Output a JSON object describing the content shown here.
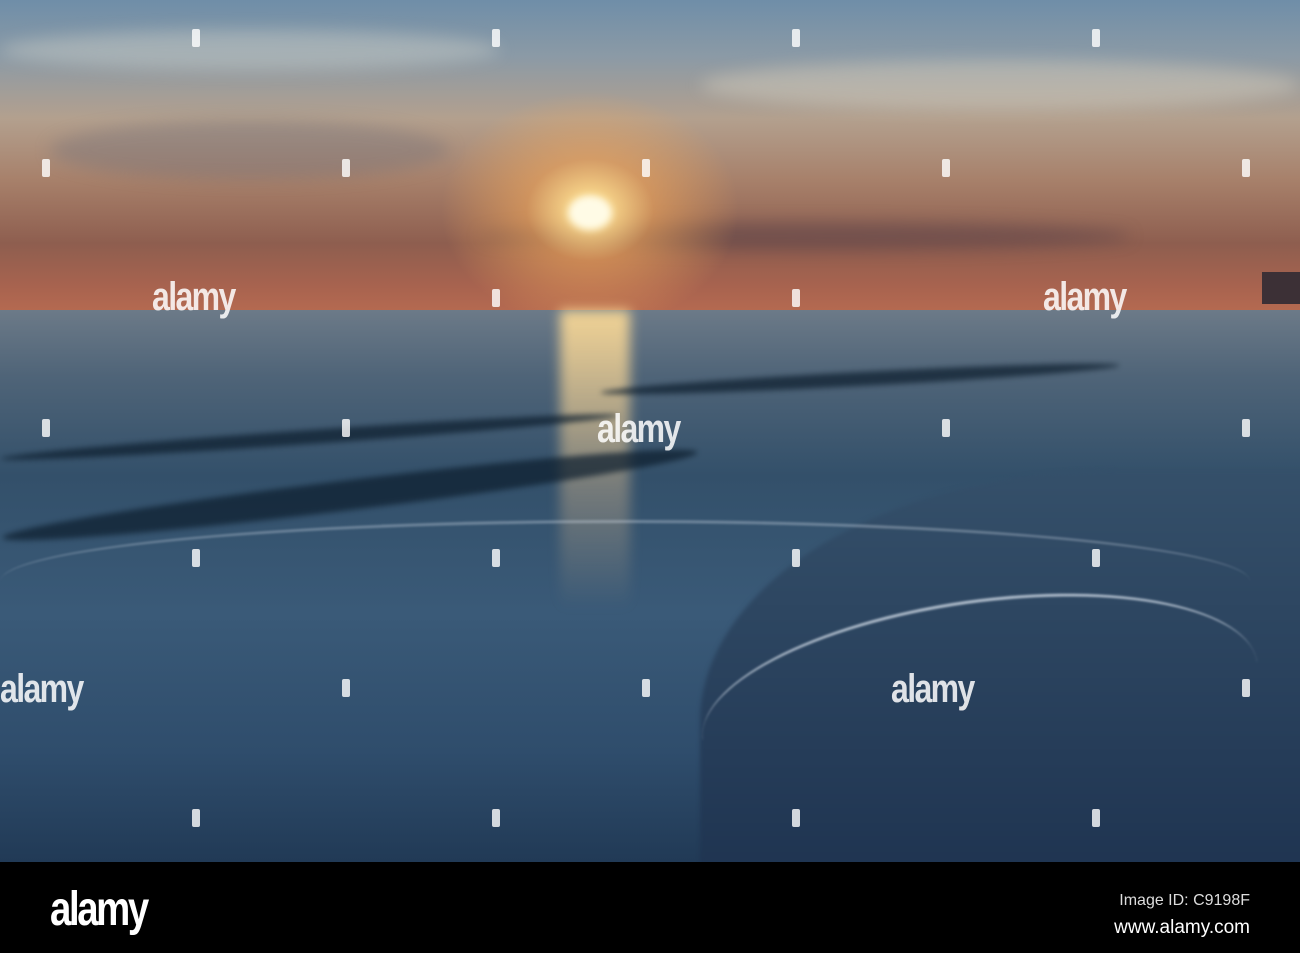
{
  "watermark": {
    "text": "alamy"
  },
  "footer": {
    "logo": "alamy",
    "image_id": "Image ID: C9198F",
    "url": "www.alamy.com"
  },
  "colors": {
    "sky_top": "#6f8ea8",
    "horizon": "#b56a50",
    "sun": "#fffbe6",
    "sea": "#33506a",
    "footer": "#000000"
  }
}
